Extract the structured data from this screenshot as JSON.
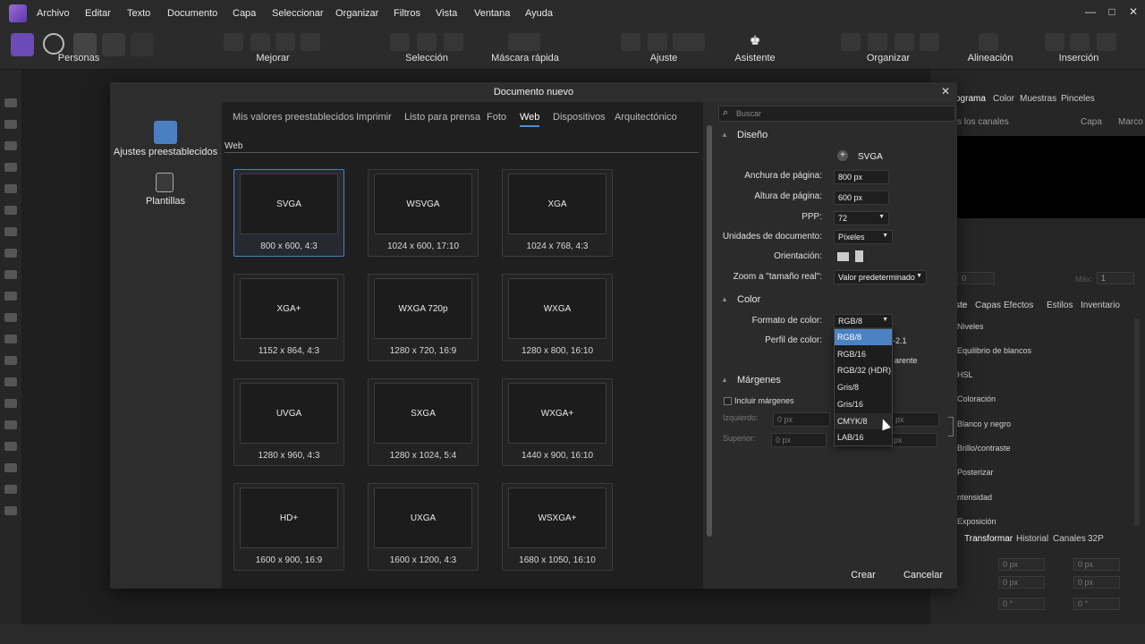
{
  "menubar": {
    "items": [
      "Archivo",
      "Editar",
      "Texto",
      "Documento",
      "Capa",
      "Seleccionar",
      "Organizar",
      "Filtros",
      "Vista",
      "Ventana",
      "Ayuda"
    ],
    "window_controls": [
      "—",
      "□",
      "✕"
    ]
  },
  "toolbar": {
    "groups": [
      "Personas",
      "Mejorar",
      "Selección",
      "Máscara rápida",
      "Ajuste",
      "Asistente",
      "Organizar",
      "Alineación",
      "Inserción"
    ]
  },
  "dialog": {
    "title": "Documento nuevo",
    "sidebar": [
      {
        "label": "Ajustes preestablecidos",
        "icon": "presets-icon"
      },
      {
        "label": "Plantillas",
        "icon": "templates-icon"
      }
    ],
    "tabs": [
      "Mis valores preestablecidos",
      "Imprimir",
      "Listo para prensa",
      "Foto",
      "Web",
      "Dispositivos",
      "Arquitectónico"
    ],
    "active_tab": "Web",
    "section_label": "Web",
    "presets": [
      {
        "name": "SVGA",
        "dims": "800 x 600, 4:3"
      },
      {
        "name": "WSVGA",
        "dims": "1024 x 600, 17:10"
      },
      {
        "name": "XGA",
        "dims": "1024 x 768, 4:3"
      },
      {
        "name": "XGA+",
        "dims": "1152 x 864, 4:3"
      },
      {
        "name": "WXGA 720p",
        "dims": "1280 x 720, 16:9"
      },
      {
        "name": "WXGA",
        "dims": "1280 x 800, 16:10"
      },
      {
        "name": "UVGA",
        "dims": "1280 x 960, 4:3"
      },
      {
        "name": "SXGA",
        "dims": "1280 x 1024, 5:4"
      },
      {
        "name": "WXGA+",
        "dims": "1440 x 900, 16:10"
      },
      {
        "name": "HD+",
        "dims": "1600 x 900, 16:9"
      },
      {
        "name": "UXGA",
        "dims": "1600 x 1200, 4:3"
      },
      {
        "name": "WSXGA+",
        "dims": "1680 x 1050, 16:10"
      }
    ],
    "search_placeholder": "Buscar",
    "design": {
      "title": "Diseño",
      "preset_name": "SVGA",
      "page_width_label": "Anchura de página:",
      "page_width": "800 px",
      "page_height_label": "Altura de página:",
      "page_height": "600 px",
      "dpi_label": "PPP:",
      "dpi": "72",
      "units_label": "Unidades de documento:",
      "units": "Píxeles",
      "orientation_label": "Orientación:",
      "zoom_label": "Zoom a \"tamaño real\":",
      "zoom": "Valor predeterminado"
    },
    "color": {
      "title": "Color",
      "format_label": "Formato de color:",
      "format": "RGB/8",
      "profile_label": "Perfil de color:",
      "profile_partial": "-2.1",
      "transparent_partial": "arente",
      "format_options": [
        "RGB/8",
        "RGB/16",
        "RGB/32 (HDR)",
        "Gris/8",
        "Gris/16",
        "CMYK/8",
        "LAB/16"
      ]
    },
    "margins": {
      "title": "Márgenes",
      "include_label": "Incluir márgenes",
      "left_label": "Izquierdo:",
      "left": "0 px",
      "top_label": "Superior:",
      "top": "0 px",
      "right": "px",
      "bottom": "px"
    },
    "create_button": "Crear",
    "cancel_button": "Cancelar"
  },
  "right_panel": {
    "tabs_top": [
      "ograma",
      "Color",
      "Muestras",
      "Pinceles"
    ],
    "channels": "s los canales",
    "layer_label": "Capa",
    "frame_label": "Marco",
    "tabs_mid": [
      "ste",
      "Capas",
      "Efectos",
      "Estilos",
      "Inventario"
    ],
    "adjustments": [
      "Niveles",
      "Equilibrio de blancos",
      "HSL",
      "Coloración",
      "Blanco y negro",
      "Brillo/contraste",
      "Posterizar",
      "ntensidad",
      "Exposición"
    ],
    "tabs_bottom": [
      "Transformar",
      "Historial",
      "Canales",
      "32P"
    ],
    "transform_fields": [
      "0 px",
      "0 px",
      "0 px",
      "0 px",
      "0 °",
      "0 °"
    ],
    "max_label": "Máx:",
    "max_value": "1",
    "min_value": "0"
  }
}
